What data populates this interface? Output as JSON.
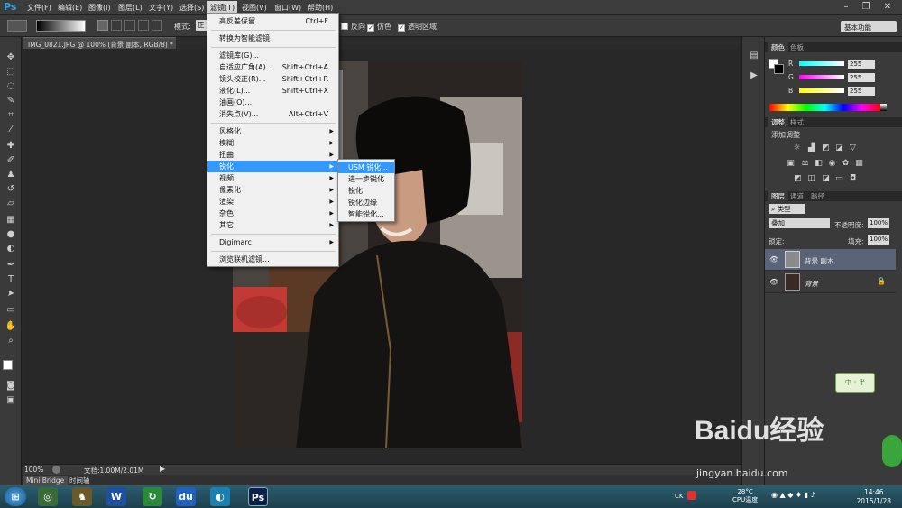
{
  "menubar": {
    "logo": "Ps",
    "items": [
      "文件(F)",
      "编辑(E)",
      "图像(I)",
      "图层(L)",
      "文字(Y)",
      "选择(S)",
      "滤镜(T)",
      "视图(V)",
      "窗口(W)",
      "帮助(H)"
    ]
  },
  "options": {
    "mode_label": "模式:",
    "mode_value": "正",
    "reverse_label": "反向",
    "dither_label": "仿色",
    "transparency_label": "透明区域",
    "workspace": "基本功能"
  },
  "document": {
    "tab_title": "IMG_0821.JPG @ 100% (背景 副本, RGB/8) *",
    "zoom": "100%",
    "doc_size": "文档:1.00M/2.01M"
  },
  "bottom_tabs": [
    "Mini Bridge",
    "时间轴"
  ],
  "filter_menu": {
    "items": [
      {
        "label": "高反差保留",
        "shortcut": "Ctrl+F"
      },
      {
        "label": "转换为智能滤镜",
        "shortcut": ""
      },
      {
        "label": "滤镜库(G)...",
        "shortcut": ""
      },
      {
        "label": "自适应广角(A)...",
        "shortcut": "Shift+Ctrl+A"
      },
      {
        "label": "镜头校正(R)...",
        "shortcut": "Shift+Ctrl+R"
      },
      {
        "label": "液化(L)...",
        "shortcut": "Shift+Ctrl+X"
      },
      {
        "label": "油画(O)...",
        "shortcut": ""
      },
      {
        "label": "消失点(V)...",
        "shortcut": "Alt+Ctrl+V"
      },
      {
        "label": "风格化",
        "shortcut": ""
      },
      {
        "label": "模糊",
        "shortcut": ""
      },
      {
        "label": "扭曲",
        "shortcut": ""
      },
      {
        "label": "锐化",
        "shortcut": ""
      },
      {
        "label": "视频",
        "shortcut": ""
      },
      {
        "label": "像素化",
        "shortcut": ""
      },
      {
        "label": "渲染",
        "shortcut": ""
      },
      {
        "label": "杂色",
        "shortcut": ""
      },
      {
        "label": "其它",
        "shortcut": ""
      },
      {
        "label": "Digimarc",
        "shortcut": ""
      },
      {
        "label": "浏览联机滤镜...",
        "shortcut": ""
      }
    ]
  },
  "sharpen_submenu": [
    "USM 锐化...",
    "进一步锐化",
    "锐化",
    "锐化边缘",
    "智能锐化..."
  ],
  "color_panel": {
    "tabs": [
      "颜色",
      "色板"
    ],
    "channels": [
      {
        "name": "R",
        "value": "255",
        "color": "#ff0000"
      },
      {
        "name": "G",
        "value": "255",
        "color": "#00ff00"
      },
      {
        "name": "B",
        "value": "255",
        "color": "#0000ff"
      }
    ]
  },
  "adjust_panel": {
    "tabs": [
      "调整",
      "样式"
    ],
    "title": "添加调整"
  },
  "layers_panel": {
    "tabs": [
      "图层",
      "通道",
      "路径"
    ],
    "kind": "类型",
    "blend_mode": "叠加",
    "opacity_label": "不透明度:",
    "opacity": "100%",
    "lock_label": "锁定:",
    "fill_label": "填充:",
    "fill": "100%",
    "layers": [
      "背景 副本",
      "背景"
    ]
  },
  "taskbar": {
    "temp": "28°C",
    "cpu": "CPU温度",
    "time": "14:46",
    "date": "2015/1/28",
    "lang": "CK"
  },
  "watermark": {
    "brand": "Baidu经验",
    "url": "jingyan.baidu.com"
  }
}
